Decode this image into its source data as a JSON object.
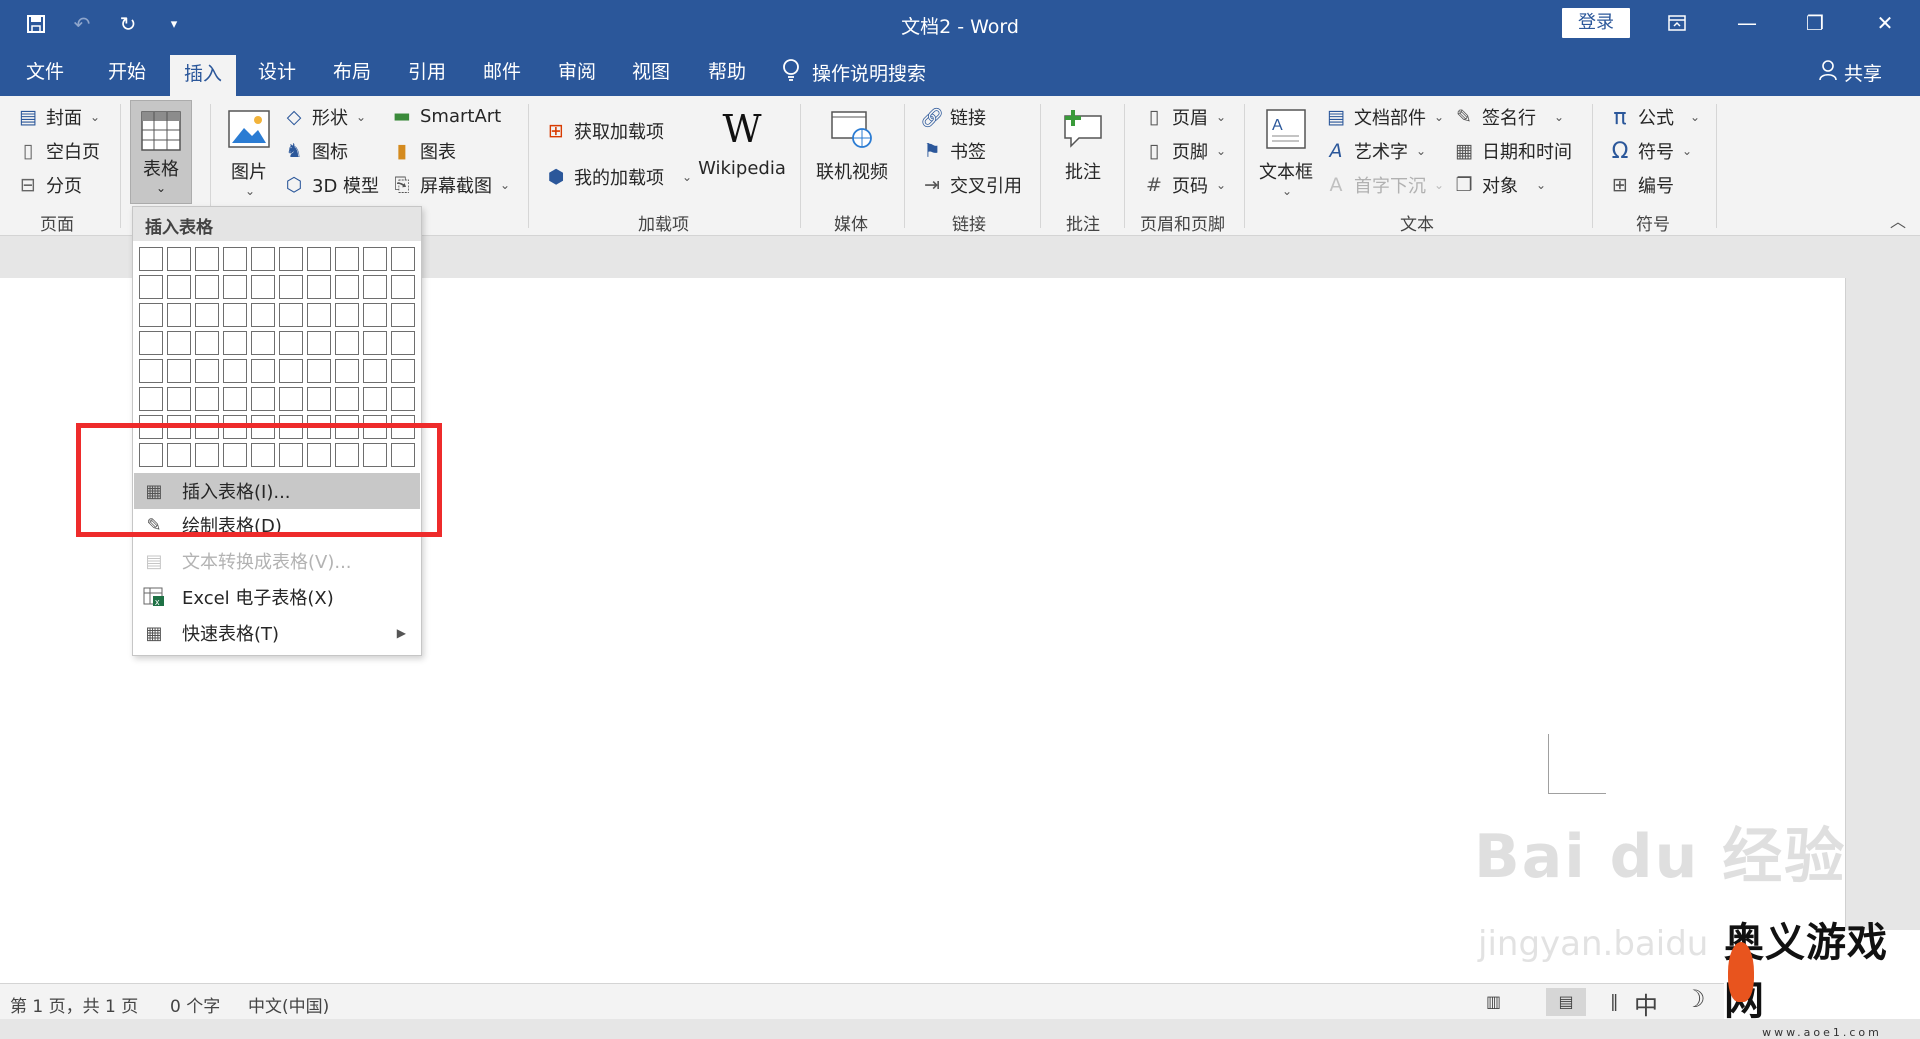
{
  "titlebar": {
    "doc_title": "文档2  -  Word",
    "login": "登录",
    "qat": {
      "save_icon": "save-icon",
      "undo_icon": "undo-icon",
      "redo_icon": "redo-icon",
      "customize_icon": "customize-qat-icon"
    }
  },
  "tabs": [
    "文件",
    "开始",
    "插入",
    "设计",
    "布局",
    "引用",
    "邮件",
    "审阅",
    "视图",
    "帮助"
  ],
  "active_tab": "插入",
  "tell_me": "操作说明搜索",
  "share": "共享",
  "ribbon": {
    "pages": {
      "cover": "封面",
      "blank": "空白页",
      "break": "分页",
      "group": "页面"
    },
    "table": {
      "label": "表格"
    },
    "illustrations": {
      "picture": "图片",
      "shapes": "形状",
      "icons": "图标",
      "model3d": "3D 模型",
      "smartart": "SmartArt",
      "chart": "图表",
      "screenshot": "屏幕截图"
    },
    "addins": {
      "get": "获取加载项",
      "my": "我的加载项",
      "wikipedia": "Wikipedia",
      "group": "加载项"
    },
    "media": {
      "video": "联机视频",
      "group": "媒体"
    },
    "links": {
      "link": "链接",
      "bookmark": "书签",
      "crossref": "交叉引用",
      "group": "链接"
    },
    "comments": {
      "comment": "批注",
      "group": "批注"
    },
    "headerfooter": {
      "header": "页眉",
      "footer": "页脚",
      "pagenum": "页码",
      "group": "页眉和页脚"
    },
    "text": {
      "textbox": "文本框",
      "parts": "文档部件",
      "wordart": "艺术字",
      "dropcap": "首字下沉",
      "sigline": "签名行",
      "datetime": "日期和时间",
      "object": "对象",
      "group": "文本"
    },
    "symbols": {
      "equation": "公式",
      "symbol": "符号",
      "number": "编号",
      "group": "符号"
    }
  },
  "dropdown": {
    "header": "插入表格",
    "grid_rows": 8,
    "grid_cols": 10,
    "items": [
      {
        "label": "插入表格(I)...",
        "state": "highlighted",
        "icon": "table-icon"
      },
      {
        "label": "绘制表格(D)",
        "state": "normal",
        "icon": "draw-table-icon"
      },
      {
        "label": "文本转换成表格(V)...",
        "state": "disabled",
        "icon": "text-to-table-icon"
      },
      {
        "label": "Excel 电子表格(X)",
        "state": "normal",
        "icon": "excel-icon"
      },
      {
        "label": "快速表格(T)",
        "state": "normal",
        "icon": "quick-table-icon"
      }
    ]
  },
  "status": {
    "page": "第 1 页，共 1 页",
    "words": "0 个字",
    "lang": "中文(中国)",
    "ime": "中"
  },
  "watermark": {
    "brand": "Bai du 经验",
    "url": "jingyan.baidu",
    "site_name": "奥义游戏网",
    "site_url": "www.aoe1.com"
  },
  "colors": {
    "word_blue": "#2b579a",
    "highlight_box": "#ee2b2b"
  }
}
